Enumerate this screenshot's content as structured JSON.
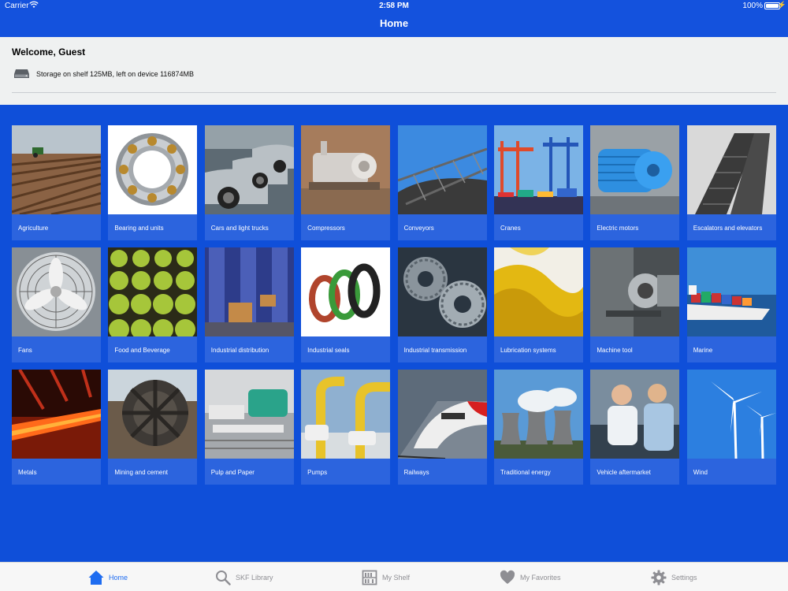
{
  "status_bar": {
    "carrier": "Carrier",
    "time": "2:58 PM",
    "battery": "100%"
  },
  "nav": {
    "title": "Home"
  },
  "welcome": {
    "greeting": "Welcome, Guest",
    "storage": "Storage on shelf 125MB, left on device 116874MB"
  },
  "industries": [
    {
      "label": "Agriculture",
      "icon": "agriculture-field"
    },
    {
      "label": "Bearing and units",
      "icon": "ball-bearing"
    },
    {
      "label": "Cars and light trucks",
      "icon": "parked-cars"
    },
    {
      "label": "Compressors",
      "icon": "compressor"
    },
    {
      "label": "Conveyors",
      "icon": "conveyor"
    },
    {
      "label": "Cranes",
      "icon": "port-cranes"
    },
    {
      "label": "Electric motors",
      "icon": "electric-motor"
    },
    {
      "label": "Escalators and elevators",
      "icon": "escalator"
    },
    {
      "label": "Fans",
      "icon": "fan"
    },
    {
      "label": "Food and Beverage",
      "icon": "apples"
    },
    {
      "label": "Industrial distribution",
      "icon": "warehouse"
    },
    {
      "label": "Industrial seals",
      "icon": "seals"
    },
    {
      "label": "Industrial transmission",
      "icon": "gears"
    },
    {
      "label": "Lubrication systems",
      "icon": "oil"
    },
    {
      "label": "Machine tool",
      "icon": "machine-tool"
    },
    {
      "label": "Marine",
      "icon": "container-ship"
    },
    {
      "label": "Metals",
      "icon": "hot-steel"
    },
    {
      "label": "Mining and cement",
      "icon": "mining-wheel"
    },
    {
      "label": "Pulp and Paper",
      "icon": "paper-machine"
    },
    {
      "label": "Pumps",
      "icon": "pipes"
    },
    {
      "label": "Railways",
      "icon": "train"
    },
    {
      "label": "Traditional energy",
      "icon": "cooling-towers"
    },
    {
      "label": "Vehicle aftermarket",
      "icon": "mechanics"
    },
    {
      "label": "Wind",
      "icon": "wind-turbines"
    }
  ],
  "tabs": [
    {
      "label": "Home",
      "icon": "home-icon",
      "active": true
    },
    {
      "label": "SKF Library",
      "icon": "search-icon",
      "active": false
    },
    {
      "label": "My Shelf",
      "icon": "shelf-icon",
      "active": false
    },
    {
      "label": "My Favorites",
      "icon": "heart-icon",
      "active": false
    },
    {
      "label": "Settings",
      "icon": "gear-icon",
      "active": false
    }
  ],
  "colors": {
    "brand_blue": "#1452dd",
    "tile_blue": "#2c64de",
    "active_tab": "#1e6cf0",
    "inactive_tab": "#8e8e93"
  }
}
